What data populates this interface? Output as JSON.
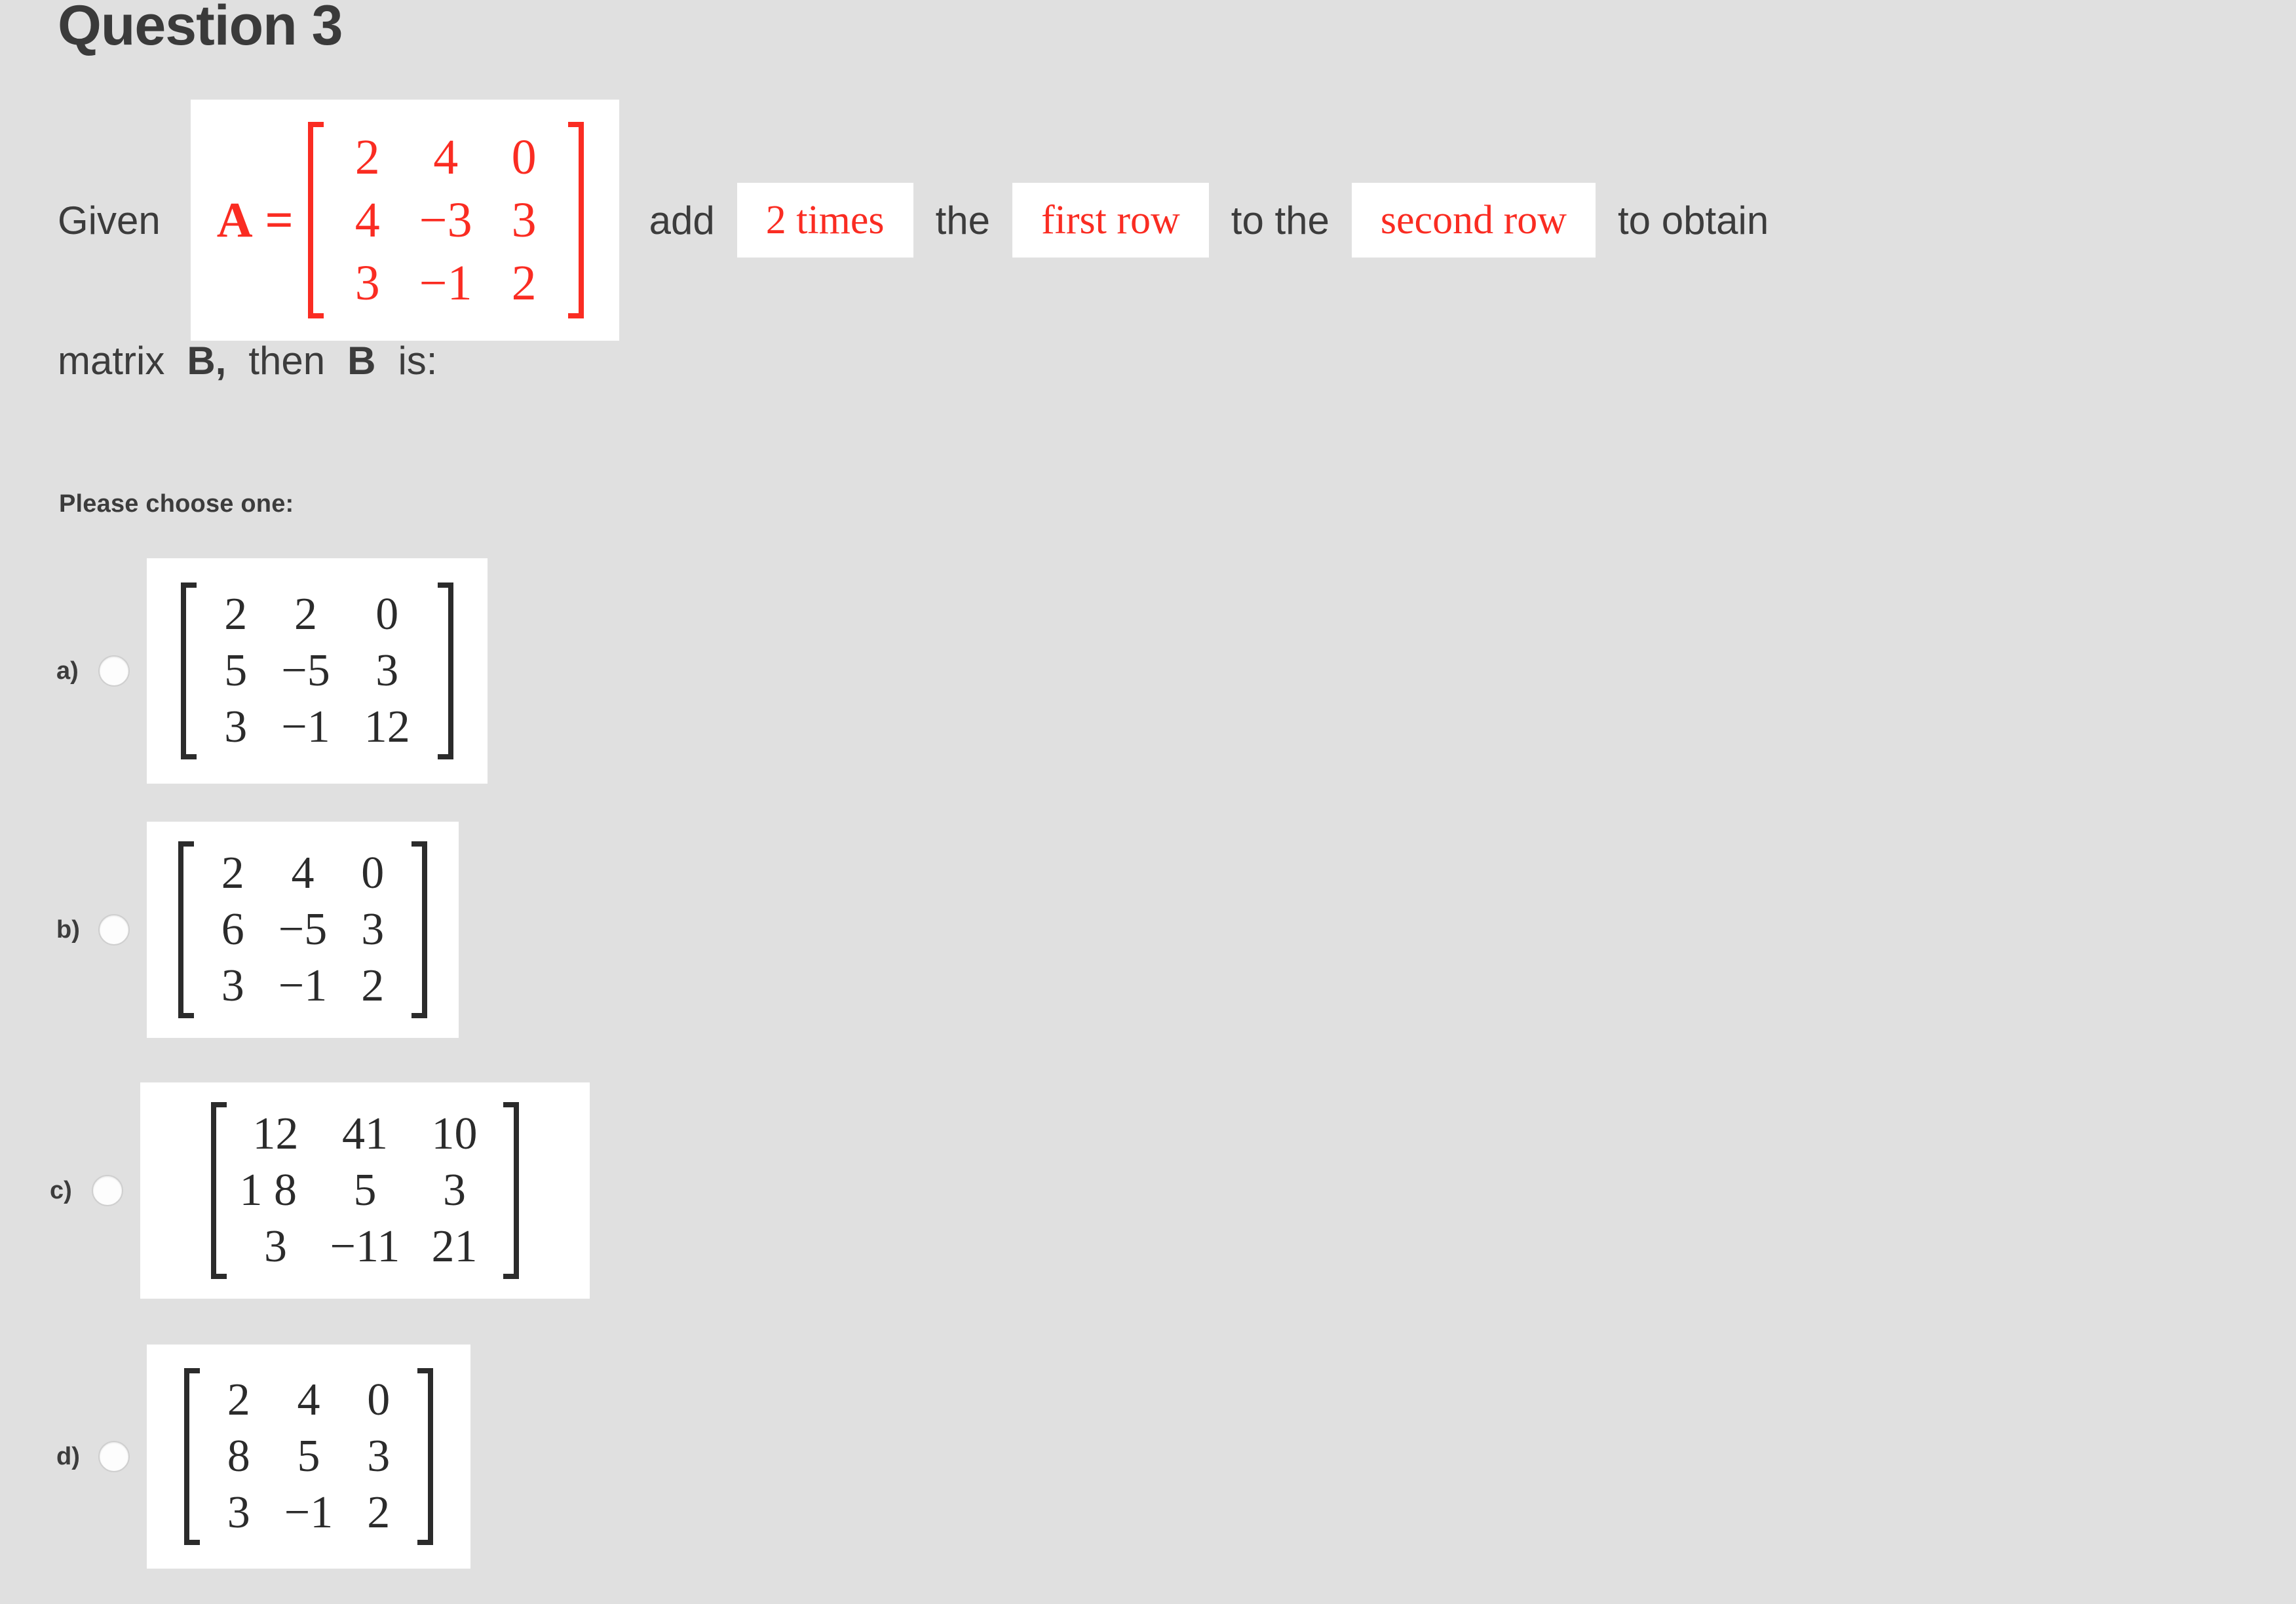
{
  "question": {
    "title": "Question 3",
    "line1": {
      "given_label": "Given",
      "matrixA": {
        "lead": "A =",
        "rows": [
          [
            "2",
            "4",
            "0"
          ],
          [
            "4",
            "−3",
            "3"
          ],
          [
            "3",
            "−1",
            "2"
          ]
        ]
      },
      "add_label": "add",
      "highlight_times": "2 times",
      "the_label": "the",
      "highlight_first_row": "first row",
      "to_the_label": "to the",
      "highlight_second_row": "second row",
      "to_obtain_label": "to obtain"
    },
    "line2": {
      "matrix_word": "matrix",
      "b_bold_1": "B,",
      "then_word": "then",
      "b_bold_2": "B",
      "is_word": "is:"
    }
  },
  "instruction": "Please choose one:",
  "options": [
    {
      "id": "a",
      "label": "a)",
      "selected": false,
      "rows": [
        [
          "2",
          "2",
          "0"
        ],
        [
          "5",
          "−5",
          "3"
        ],
        [
          "3",
          "−1",
          "12"
        ]
      ]
    },
    {
      "id": "b",
      "label": "b)",
      "selected": false,
      "rows": [
        [
          "2",
          "4",
          "0"
        ],
        [
          "6",
          "−5",
          "3"
        ],
        [
          "3",
          "−1",
          "2"
        ]
      ]
    },
    {
      "id": "c",
      "label": "c)",
      "selected": false,
      "rows": [
        [
          "12",
          "41",
          "10"
        ],
        [
          "1 8",
          "5",
          "3"
        ],
        [
          "3",
          "−11",
          "21"
        ]
      ]
    },
    {
      "id": "d",
      "label": "d)",
      "selected": false,
      "rows": [
        [
          "2",
          "4",
          "0"
        ],
        [
          "8",
          "5",
          "3"
        ],
        [
          "3",
          "−1",
          "2"
        ]
      ]
    }
  ],
  "colors": {
    "background": "#e0e0e0",
    "box_background": "#ffffff",
    "text": "#3c3c3c",
    "highlight_red": "#fa2c22",
    "matrix_black": "#2b2b2b",
    "radio_border": "#cfcfcf"
  }
}
